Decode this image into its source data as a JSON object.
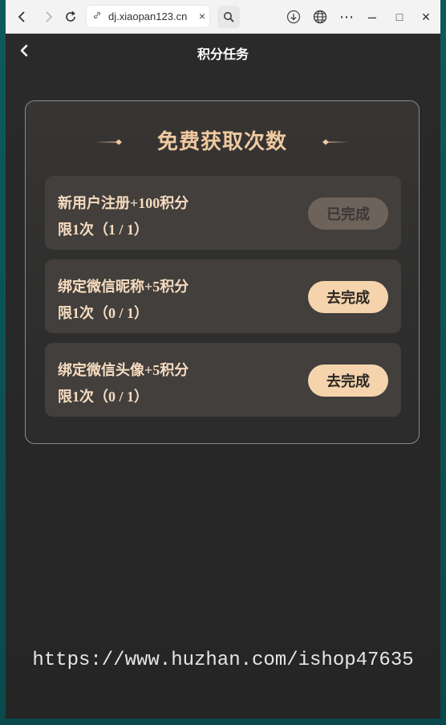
{
  "browser": {
    "url": "dj.xiaopan123.cn",
    "back_icon": "‹",
    "forward_icon": "›",
    "reload_icon": "↻",
    "close_tab": "×",
    "controls": {
      "menu": "⋯",
      "minimize": "–",
      "maximize": "□",
      "close": "✕"
    }
  },
  "page": {
    "title": "积分任务",
    "back": "‹"
  },
  "card": {
    "heading": "免费获取次数",
    "tasks": [
      {
        "name": "新用户注册+100积分",
        "limit": "限1次（1 / 1）",
        "button": "已完成",
        "state": "done"
      },
      {
        "name": "绑定微信昵称+5积分",
        "limit": "限1次（0 / 1）",
        "button": "去完成",
        "state": "todo"
      },
      {
        "name": "绑定微信头像+5积分",
        "limit": "限1次（0 / 1）",
        "button": "去完成",
        "state": "todo"
      }
    ]
  },
  "watermark": "https://www.huzhan.com/ishop47635",
  "colors": {
    "accent": "#f4d3ad",
    "title": "#f0c9a0",
    "bg": "#262626"
  }
}
